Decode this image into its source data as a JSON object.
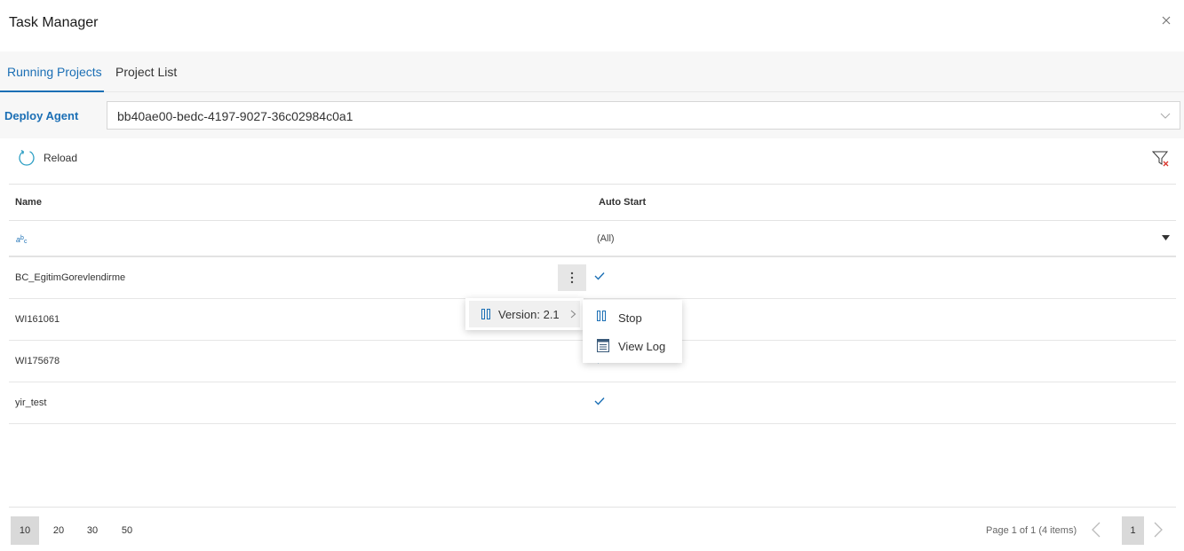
{
  "dialog": {
    "title": "Task Manager"
  },
  "tabs": [
    {
      "label": "Running Projects",
      "active": true
    },
    {
      "label": "Project List",
      "active": false
    }
  ],
  "agent": {
    "label": "Deploy Agent",
    "value": "bb40ae00-bedc-4197-9027-36c02984c0a1"
  },
  "toolbar": {
    "reload_label": "Reload"
  },
  "grid": {
    "columns": [
      "Name",
      "Auto Start"
    ],
    "filter": {
      "auto_start_value": "(All)"
    },
    "rows": [
      {
        "name": "BC_EgitimGorevlendirme",
        "auto_start": true
      },
      {
        "name": "WI161061",
        "auto_start": true
      },
      {
        "name": "WI175678",
        "auto_start": true
      },
      {
        "name": "yir_test",
        "auto_start": true
      }
    ]
  },
  "context_menu": {
    "version_label": "Version: 2.1",
    "submenu": [
      {
        "label": "Stop",
        "icon": "stop-icon"
      },
      {
        "label": "View Log",
        "icon": "log-icon"
      }
    ]
  },
  "pager": {
    "sizes": [
      "10",
      "20",
      "30",
      "50"
    ],
    "selected_size": "10",
    "info": "Page 1 of 1 (4 items)",
    "current_page": "1"
  },
  "colors": {
    "accent": "#1b6fb5",
    "check": "#1b6fb5",
    "clear_filter": "#d9342b"
  }
}
